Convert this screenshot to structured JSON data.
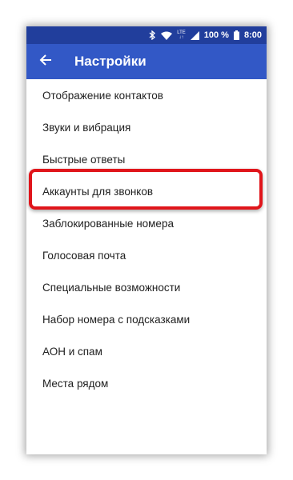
{
  "status_bar": {
    "lte_label": "LTE",
    "battery": "100 %",
    "time": "8:00"
  },
  "app_bar": {
    "title": "Настройки"
  },
  "settings": {
    "items": [
      "Отображение контактов",
      "Звуки и вибрация",
      "Быстрые ответы",
      "Аккаунты для звонков",
      "Заблокированные номера",
      "Голосовая почта",
      "Специальные возможности",
      "Набор номера с подсказками",
      "АОН и спам",
      "Места рядом"
    ]
  },
  "colors": {
    "status_bar": "#213e9c",
    "app_bar": "#3258c6",
    "highlight": "#e0151b"
  }
}
